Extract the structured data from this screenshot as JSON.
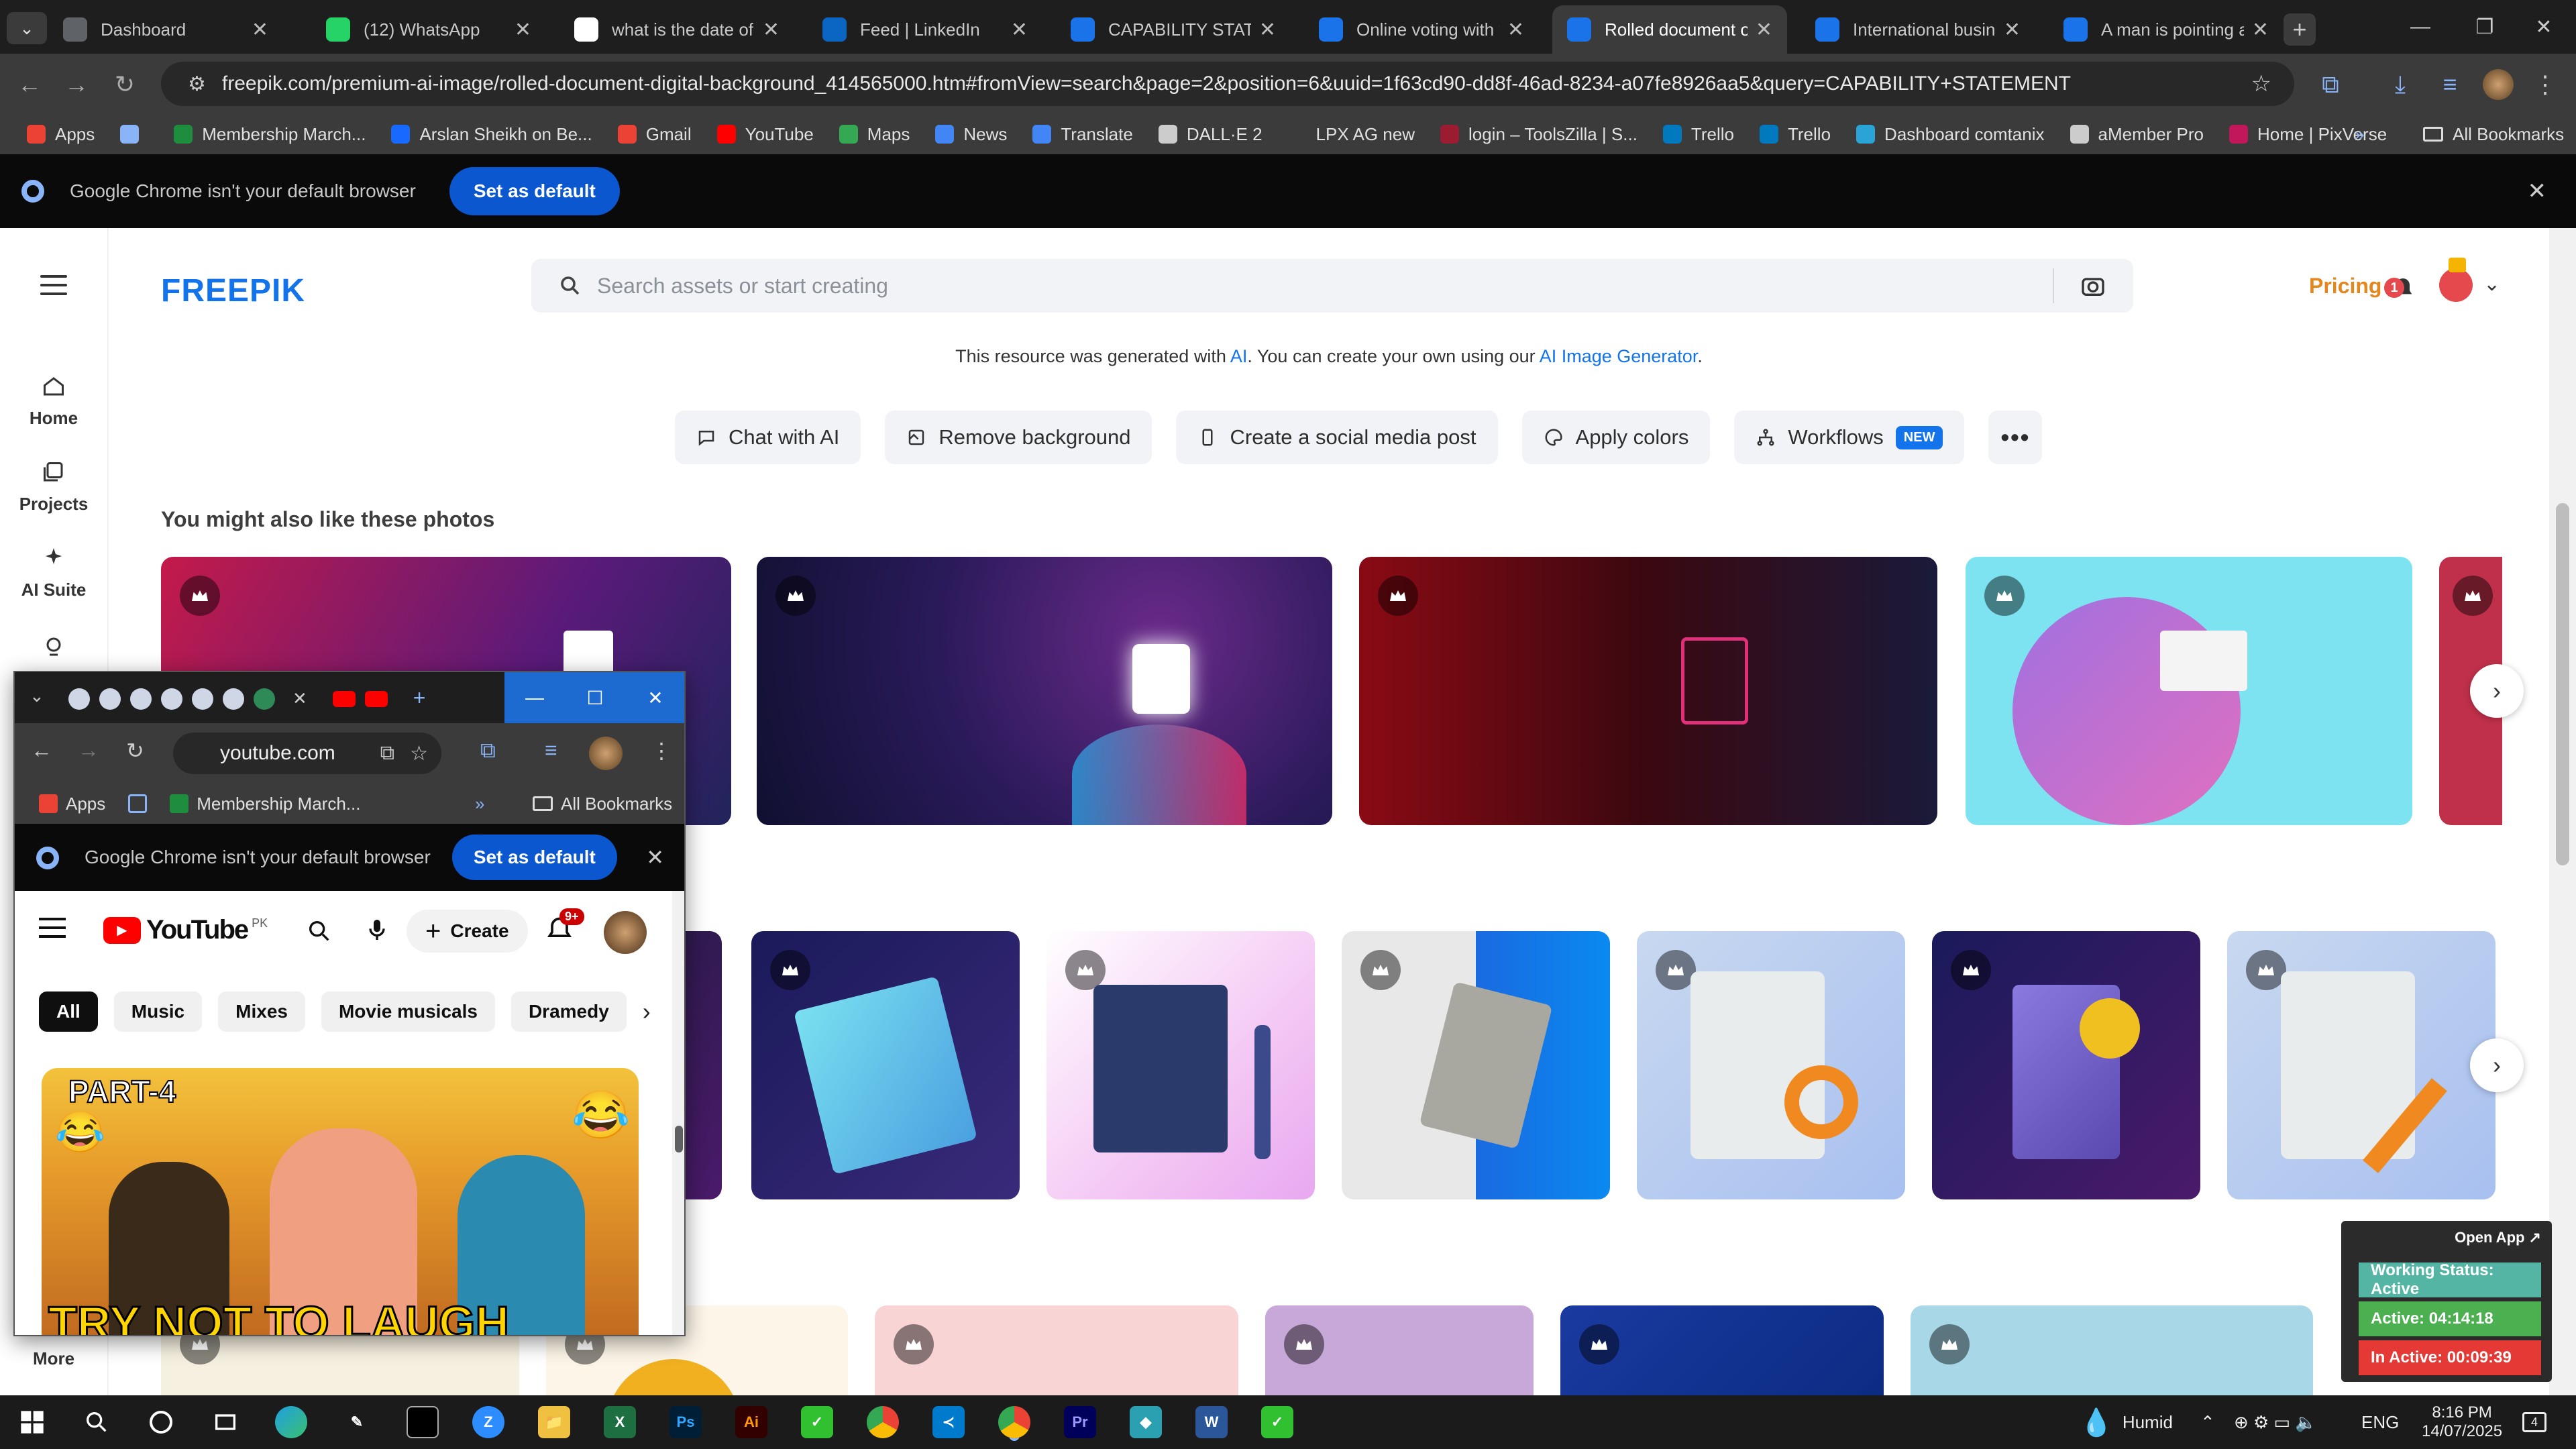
{
  "browser": {
    "tabs": [
      {
        "title": "Dashboard",
        "icon": "globe-icon",
        "color": "#5f6368"
      },
      {
        "title": "(12) WhatsApp",
        "icon": "whatsapp-icon",
        "color": "#25d366"
      },
      {
        "title": "what is the date of bi",
        "icon": "google-icon",
        "color": "#ffffff"
      },
      {
        "title": "Feed | LinkedIn",
        "icon": "linkedin-icon",
        "color": "#0a66c2"
      },
      {
        "title": "CAPABILITY STATEME",
        "icon": "docs-icon",
        "color": "#1a73e8"
      },
      {
        "title": "Online voting with vo",
        "icon": "docs-icon",
        "color": "#1a73e8"
      },
      {
        "title": "Rolled document on",
        "icon": "docs-icon",
        "color": "#1a73e8",
        "active": true
      },
      {
        "title": "International busine",
        "icon": "docs-icon",
        "color": "#1a73e8"
      },
      {
        "title": "A man is pointing at",
        "icon": "docs-icon",
        "color": "#1a73e8"
      }
    ],
    "url": "freepik.com/premium-ai-image/rolled-document-digital-background_414565000.htm#fromView=search&page=2&position=6&uuid=1f63cd90-dd8f-46ad-8234-a07fe8926aa5&query=CAPABILITY+STATEMENT",
    "bookmarks": [
      {
        "label": "Apps",
        "color": "#ea4335"
      },
      {
        "label": "",
        "color": "#8ab4f8"
      },
      {
        "label": "Membership March...",
        "color": "#1e8e3e"
      },
      {
        "label": "Arslan Sheikh on Be...",
        "color": "#1769ff"
      },
      {
        "label": "Gmail",
        "color": "#ea4335"
      },
      {
        "label": "YouTube",
        "color": "#ff0000"
      },
      {
        "label": "Maps",
        "color": "#34a853"
      },
      {
        "label": "News",
        "color": "#4285f4"
      },
      {
        "label": "Translate",
        "color": "#4285f4"
      },
      {
        "label": "DALL·E 2",
        "color": "#cccccc"
      },
      {
        "label": "LPX AG new",
        "color": "#3b3b3b"
      },
      {
        "label": "login – ToolsZilla | S...",
        "color": "#9b1c31"
      },
      {
        "label": "Trello",
        "color": "#0079bf"
      },
      {
        "label": "Trello",
        "color": "#0079bf"
      },
      {
        "label": "Dashboard comtanix",
        "color": "#2aa3d6"
      },
      {
        "label": "aMember Pro",
        "color": "#cccccc"
      },
      {
        "label": "Home | PixVerse",
        "color": "#c2185b"
      }
    ],
    "all_bookmarks": "All Bookmarks",
    "infobar_text": "Google Chrome isn't your default browser",
    "set_default": "Set as default"
  },
  "freepik": {
    "logo": "FREEPIK",
    "search_placeholder": "Search assets or start creating",
    "pricing": "Pricing",
    "notif_count": "1",
    "notice_pre": "This resource was generated with",
    "notice_ai": "AI",
    "notice_mid": ". You can create your own using our",
    "notice_link": "AI Image Generator",
    "notice_end": ".",
    "sidebar": [
      {
        "label": "Home",
        "icon": "home-icon"
      },
      {
        "label": "Projects",
        "icon": "projects-icon"
      },
      {
        "label": "AI Suite",
        "icon": "sparkle-icon"
      },
      {
        "label": "More",
        "icon": "more-icon"
      }
    ],
    "chips": [
      {
        "label": "Chat with AI",
        "icon": "chat-icon"
      },
      {
        "label": "Remove background",
        "icon": "remove-bg-icon"
      },
      {
        "label": "Create a social media post",
        "icon": "phone-icon"
      },
      {
        "label": "Apply colors",
        "icon": "palette-icon"
      },
      {
        "label": "Workflows",
        "icon": "workflow-icon",
        "badge": "NEW"
      }
    ],
    "section_title": "You might also like these photos"
  },
  "popup": {
    "url": "youtube.com",
    "bookmark1": "Apps",
    "bookmark2": "Membership March...",
    "all_bookmarks": "All Bookmarks",
    "infobar_text": "Google Chrome isn't your default browser",
    "set_default": "Set as default",
    "yt_logo": "YouTube",
    "yt_region": "PK",
    "create": "Create",
    "notif": "9+",
    "chips": [
      "All",
      "Music",
      "Mixes",
      "Movie musicals",
      "Dramedy"
    ],
    "thumb_top": "PART-4",
    "thumb_bottom": "TRY NOT TO LAUGH"
  },
  "widget": {
    "open_app": "Open App ↗",
    "status": "Working Status: Active",
    "active": "Active: 04:14:18",
    "inactive": "In Active: 00:09:39"
  },
  "taskbar": {
    "weather": "Humid",
    "lang": "ENG",
    "time": "8:16 PM",
    "date": "14/07/2025",
    "notifications": "4"
  }
}
